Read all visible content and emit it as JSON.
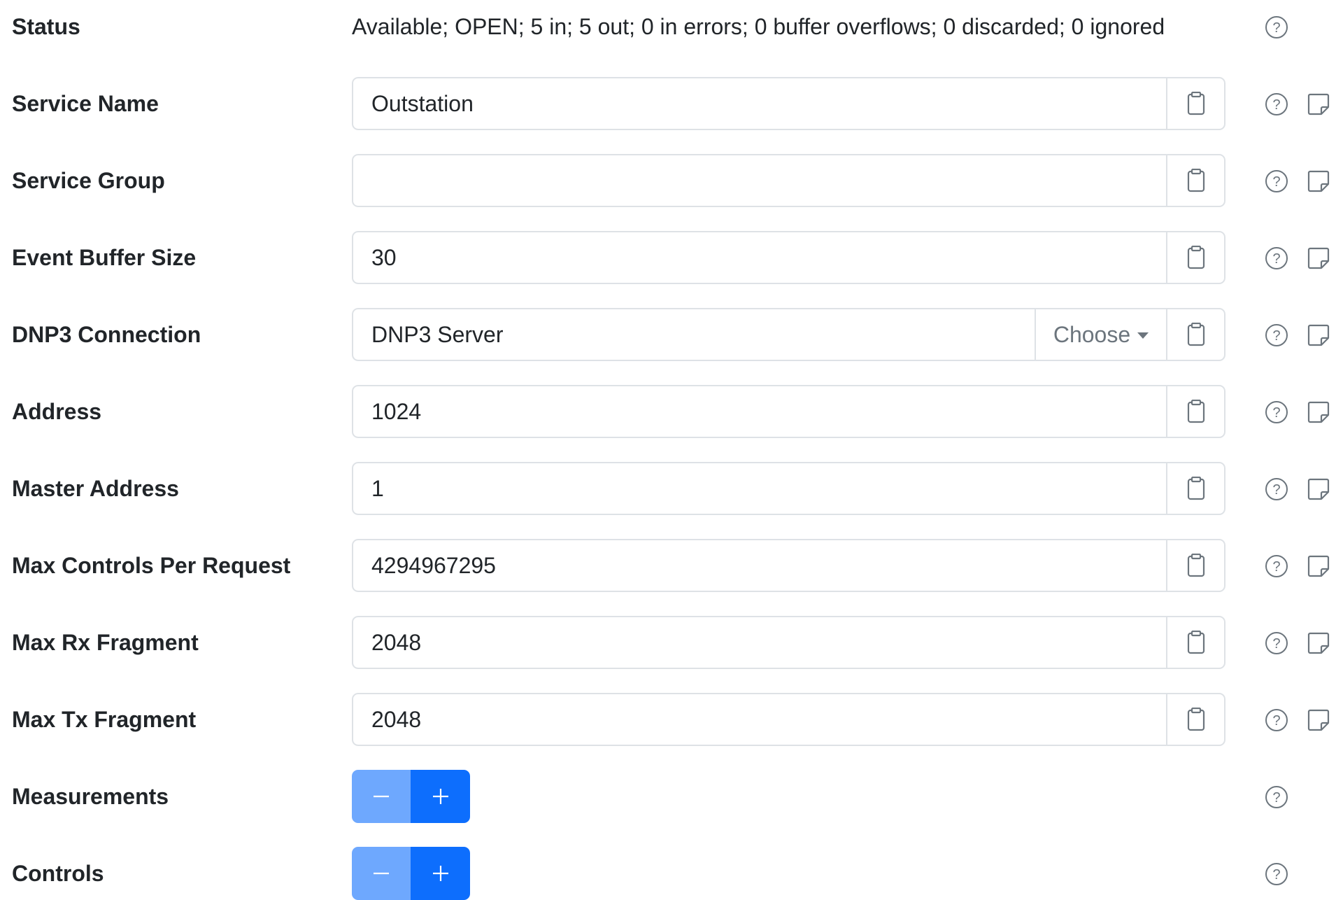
{
  "status": {
    "label": "Status",
    "value": "Available; OPEN; 5 in; 5 out; 0 in errors; 0 buffer overflows; 0 discarded; 0 ignored"
  },
  "fields": {
    "service_name": {
      "label": "Service Name",
      "value": "Outstation"
    },
    "service_group": {
      "label": "Service Group",
      "value": ""
    },
    "event_buffer_size": {
      "label": "Event Buffer Size",
      "value": "30"
    },
    "dnp3_connection": {
      "label": "DNP3 Connection",
      "value": "DNP3 Server",
      "choose_label": "Choose"
    },
    "address": {
      "label": "Address",
      "value": "1024"
    },
    "master_address": {
      "label": "Master Address",
      "value": "1"
    },
    "max_controls_per_request": {
      "label": "Max Controls Per Request",
      "value": "4294967295"
    },
    "max_rx_fragment": {
      "label": "Max Rx Fragment",
      "value": "2048"
    },
    "max_tx_fragment": {
      "label": "Max Tx Fragment",
      "value": "2048"
    }
  },
  "lists": {
    "measurements": {
      "label": "Measurements"
    },
    "controls": {
      "label": "Controls"
    }
  },
  "icons": {
    "help": "question-circle-icon",
    "note": "sticky-note-icon",
    "clipboard": "clipboard-icon",
    "minus": "minus-icon",
    "plus": "plus-icon",
    "dropdown": "caret-down-icon"
  },
  "colors": {
    "primary": "#0d6efd",
    "primary_light": "#6ea8fe",
    "border": "#dee2e6",
    "icon_gray": "#6c757d",
    "text": "#212529"
  }
}
